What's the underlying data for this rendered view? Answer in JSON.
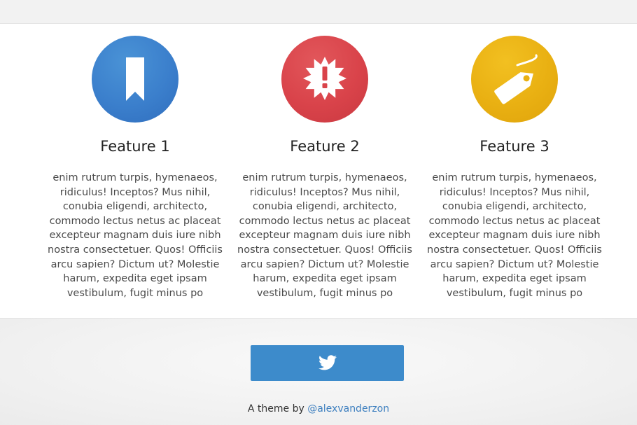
{
  "features": [
    {
      "icon": "bookmark-icon",
      "color": "#3b7fcc",
      "title": "Feature 1",
      "body": "enim rutrum turpis, hymenaeos, ridiculus! Inceptos? Mus nihil, conubia eligendi, architecto, commodo lectus netus ac placeat excepteur magnam duis iure nibh nostra consectetuer. Quos! Officiis arcu sapien? Dictum ut? Molestie harum, expedita eget ipsam vestibulum, fugit minus po"
    },
    {
      "icon": "alert-badge-icon",
      "color": "#d9434a",
      "title": "Feature 2",
      "body": "enim rutrum turpis, hymenaeos, ridiculus! Inceptos? Mus nihil, conubia eligendi, architecto, commodo lectus netus ac placeat excepteur magnam duis iure nibh nostra consectetuer. Quos! Officiis arcu sapien? Dictum ut? Molestie harum, expedita eget ipsam vestibulum, fugit minus po"
    },
    {
      "icon": "price-tag-icon",
      "color": "#e9b012",
      "title": "Feature 3",
      "body": "enim rutrum turpis, hymenaeos, ridiculus! Inceptos? Mus nihil, conubia eligendi, architecto, commodo lectus netus ac placeat excepteur magnam duis iure nibh nostra consectetuer. Quos! Officiis arcu sapien? Dictum ut? Molestie harum, expedita eget ipsam vestibulum, fugit minus po"
    }
  ],
  "footer": {
    "tweet_button_icon": "twitter-bird-icon",
    "tweet_button_color": "#3d8bcb",
    "credit_prefix": "A theme by ",
    "credit_link": "@alexvanderzon",
    "link_color": "#3d7fbf"
  }
}
